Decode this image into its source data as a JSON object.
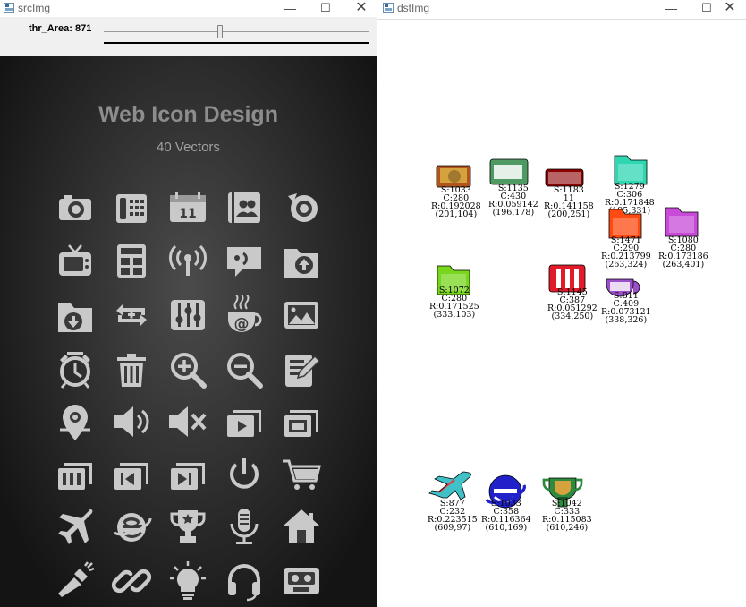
{
  "windows": {
    "src": {
      "title": "srcImg",
      "minimize": "—",
      "maximize": "☐",
      "close": "✕"
    },
    "dst": {
      "title": "dstImg",
      "minimize": "—",
      "maximize": "☐",
      "close": "✕"
    }
  },
  "trackbar": {
    "label": "thr_Area: 871",
    "value": 871,
    "max": 2000
  },
  "poster": {
    "title": "Web Icon Design",
    "subtitle": "40 Vectors",
    "icon_color": "#c9c9c9",
    "icons": [
      "camera-icon",
      "fax-phone-icon",
      "calendar-icon",
      "contacts-icon",
      "webcam-icon",
      "tv-icon",
      "calculator-icon",
      "broadcast-icon",
      "chat-icon",
      "upload-folder-icon",
      "download-folder-icon",
      "sync-icon",
      "equalizer-icon",
      "coffee-email-icon",
      "image-icon",
      "alarm-clock-icon",
      "trash-icon",
      "zoom-in-icon",
      "zoom-out-icon",
      "edit-document-icon",
      "location-pin-icon",
      "volume-up-icon",
      "mute-icon",
      "play-media-icon",
      "windows-icon",
      "film-icon",
      "skip-back-icon",
      "skip-forward-icon",
      "power-icon",
      "cart-icon",
      "airplane-icon",
      "browser-e-icon",
      "trophy-icon",
      "microphone-icon",
      "home-icon",
      "flashlight-icon",
      "link-icon",
      "lightbulb-icon",
      "headset-icon",
      "cassette-icon"
    ],
    "calendar_number": "11"
  },
  "results": [
    {
      "id": "camera",
      "color": "#b0541e",
      "icon": "camera",
      "lines": [
        "S:1033",
        "C:280",
        "R:0.192028",
        "(201,104)"
      ]
    },
    {
      "id": "fax",
      "color": "#4f9a63",
      "icon": "fax",
      "lines": [
        "S:1135",
        "C:430",
        "R:0.059142",
        "(196,178)"
      ]
    },
    {
      "id": "calendar",
      "color": "#8b0000",
      "icon": "calendar",
      "lines": [
        "S:1183",
        "11",
        "R:0.141158",
        "(200,251)"
      ]
    },
    {
      "id": "folder-teal",
      "color": "#2fd6b2",
      "icon": "folder",
      "lines": [
        "S:1279",
        "C:306",
        "R:0.171848",
        "(195,331)"
      ]
    },
    {
      "id": "folder-orange",
      "color": "#ff4b12",
      "icon": "folder",
      "lines": [
        "S:1471",
        "C:290",
        "R:0.213799",
        "(263,324)"
      ]
    },
    {
      "id": "folder-purple",
      "color": "#c84bd8",
      "icon": "folder",
      "lines": [
        "S:1080",
        "C:280",
        "R:0.173186",
        "(263,401)"
      ]
    },
    {
      "id": "folder-green",
      "color": "#78d61e",
      "icon": "folder",
      "lines": [
        "S:1072",
        "C:280",
        "R:0.171525",
        "(333,103)"
      ]
    },
    {
      "id": "equalizer",
      "color": "#e21a2a",
      "icon": "eq",
      "lines": [
        "S:1145",
        "C:387",
        "R:0.051292",
        "(334,250)"
      ]
    },
    {
      "id": "cup",
      "color": "#9b4fc9",
      "icon": "cup",
      "lines": [
        "S:811",
        "C:409",
        "R:0.073121",
        "(338,326)"
      ]
    },
    {
      "id": "airplane",
      "color": "#3fc1c7",
      "icon": "plane",
      "lines": [
        "S:877",
        "C:232",
        "R:0.223515",
        "(609,97)"
      ]
    },
    {
      "id": "browser",
      "color": "#2121c9",
      "icon": "e",
      "lines": [
        "S:1033",
        "C:358",
        "R:0.116364",
        "(610,169)"
      ]
    },
    {
      "id": "trophy",
      "color": "#2f8a40",
      "icon": "trophy",
      "lines": [
        "S:1042",
        "C:333",
        "R:0.115083",
        "(610,246)"
      ]
    }
  ]
}
